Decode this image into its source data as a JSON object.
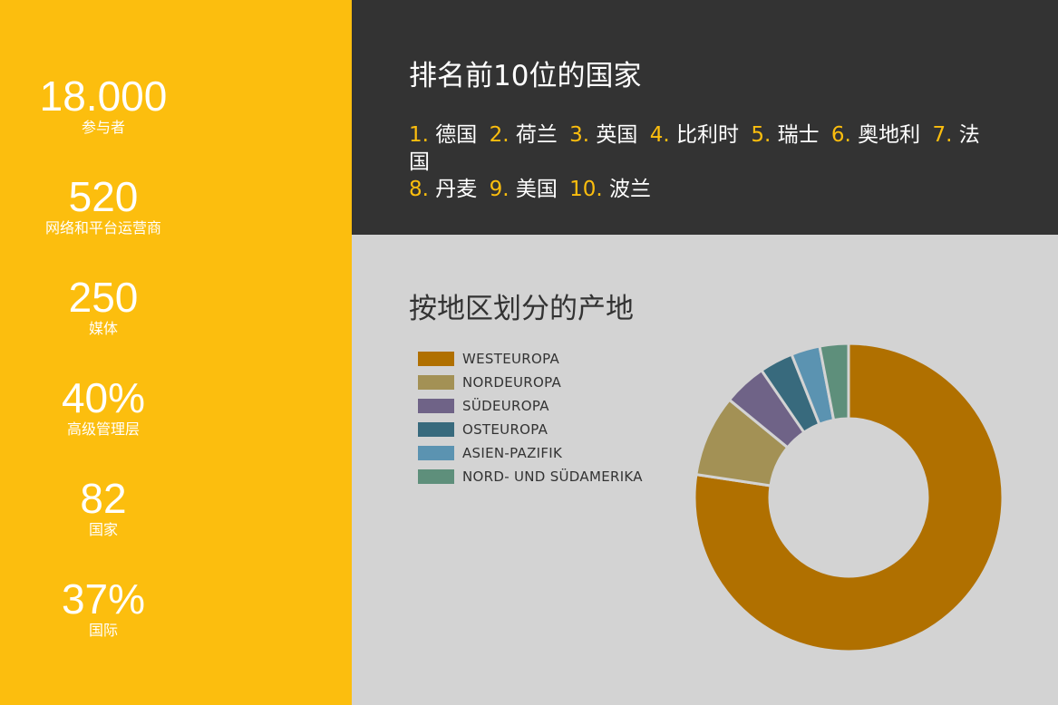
{
  "stats": [
    {
      "value": "18.000",
      "label": "参与者"
    },
    {
      "value": "520",
      "label": "网络和平台运营商"
    },
    {
      "value": "250",
      "label": "媒体"
    },
    {
      "value": "40%",
      "label": "高级管理层"
    },
    {
      "value": "82",
      "label": "国家"
    },
    {
      "value": "37%",
      "label": "国际"
    }
  ],
  "top_countries": {
    "title": "排名前10位的国家",
    "items": [
      {
        "rank": "1.",
        "name": "德国"
      },
      {
        "rank": "2.",
        "name": "荷兰"
      },
      {
        "rank": "3.",
        "name": "英国"
      },
      {
        "rank": "4.",
        "name": "比利时"
      },
      {
        "rank": "5.",
        "name": "瑞士"
      },
      {
        "rank": "6.",
        "name": "奥地利"
      },
      {
        "rank": "7.",
        "name": "法国"
      },
      {
        "rank": "8.",
        "name": "丹麦"
      },
      {
        "rank": "9.",
        "name": "美国"
      },
      {
        "rank": "10.",
        "name": "波兰"
      }
    ]
  },
  "colors": {
    "accent": "#fcbe0e",
    "dark": "#333333",
    "light_bg": "#d3d3d3"
  },
  "chart_data": {
    "type": "pie",
    "variant": "donut",
    "title": "按地区划分的产地",
    "legend_position": "left",
    "series": [
      {
        "name": "WESTEUROPA",
        "value": 77,
        "color": "#b07000"
      },
      {
        "name": "NORDEUROPA",
        "value": 8.5,
        "color": "#a39155"
      },
      {
        "name": "SÜDEUROPA",
        "value": 4.5,
        "color": "#6f6387"
      },
      {
        "name": "OSTEUROPA",
        "value": 3.5,
        "color": "#386a7d"
      },
      {
        "name": "ASIEN-PAZIFIK",
        "value": 3,
        "color": "#5b93b1"
      },
      {
        "name": "NORD- UND SÜDAMERIKA",
        "value": 3,
        "color": "#5e8f7b"
      }
    ]
  }
}
